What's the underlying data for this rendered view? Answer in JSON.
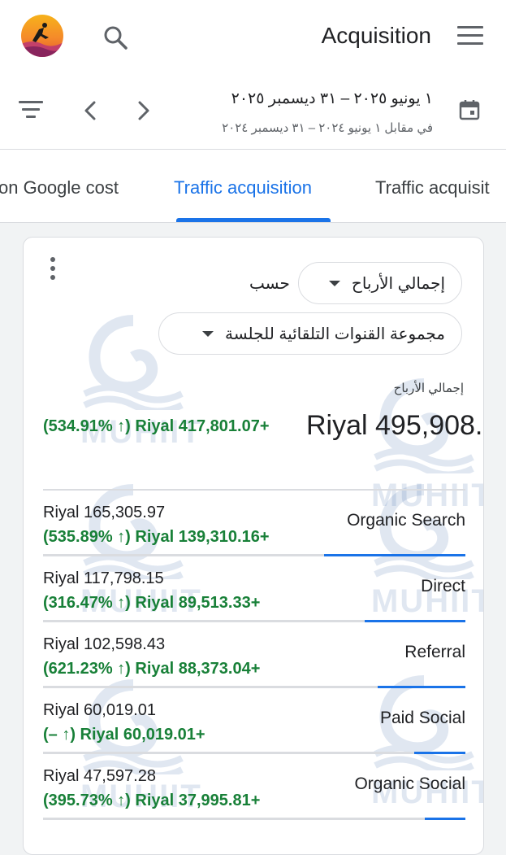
{
  "header": {
    "title": "Acquisition",
    "avatar_icon": "user-avatar-icon",
    "search_icon": "search-icon",
    "menu_icon": "hamburger-menu-icon"
  },
  "date_range": {
    "primary": "١ يونيو ٢٠٢٥ – ٣١ ديسمبر ٢٠٢٥",
    "comparison": "في مقابل ١ يونيو ٢٠٢٤ – ٣١ ديسمبر ٢٠٢٤"
  },
  "tabs": [
    {
      "label": "on Google cost"
    },
    {
      "label": "Traffic acquisition"
    },
    {
      "label": "Traffic acquisit"
    }
  ],
  "card": {
    "metric_selector": "إجمالي الأرباح",
    "by_label": "حسب",
    "dimension_selector": "مجموعة القنوات التلقائية للجلسة",
    "metric_label": "إجمالي الأرباح",
    "total_value": "Riyal 495,908.",
    "total_change": "(534.91% ↑) Riyal 417,801.07+",
    "rows": [
      {
        "name": "Organic Search",
        "value": "Riyal 165,305.97",
        "change": "(535.89% ↑) Riyal 139,310.16+",
        "share": 0.334
      },
      {
        "name": "Direct",
        "value": "Riyal 117,798.15",
        "change": "(316.47% ↑) Riyal 89,513.33+",
        "share": 0.238
      },
      {
        "name": "Referral",
        "value": "Riyal 102,598.43",
        "change": "(621.23% ↑) Riyal 88,373.04+",
        "share": 0.207
      },
      {
        "name": "Paid Social",
        "value": "Riyal 60,019.01",
        "change": "(– ↑) Riyal 60,019.01+",
        "share": 0.121
      },
      {
        "name": "Organic Social",
        "value": "Riyal 47,597.28",
        "change": "(395.73% ↑) Riyal 37,995.81+",
        "share": 0.096
      }
    ]
  },
  "watermark": {
    "text": "MUHIIT"
  },
  "colors": {
    "accent": "#1a73e8",
    "positive": "#188038"
  }
}
